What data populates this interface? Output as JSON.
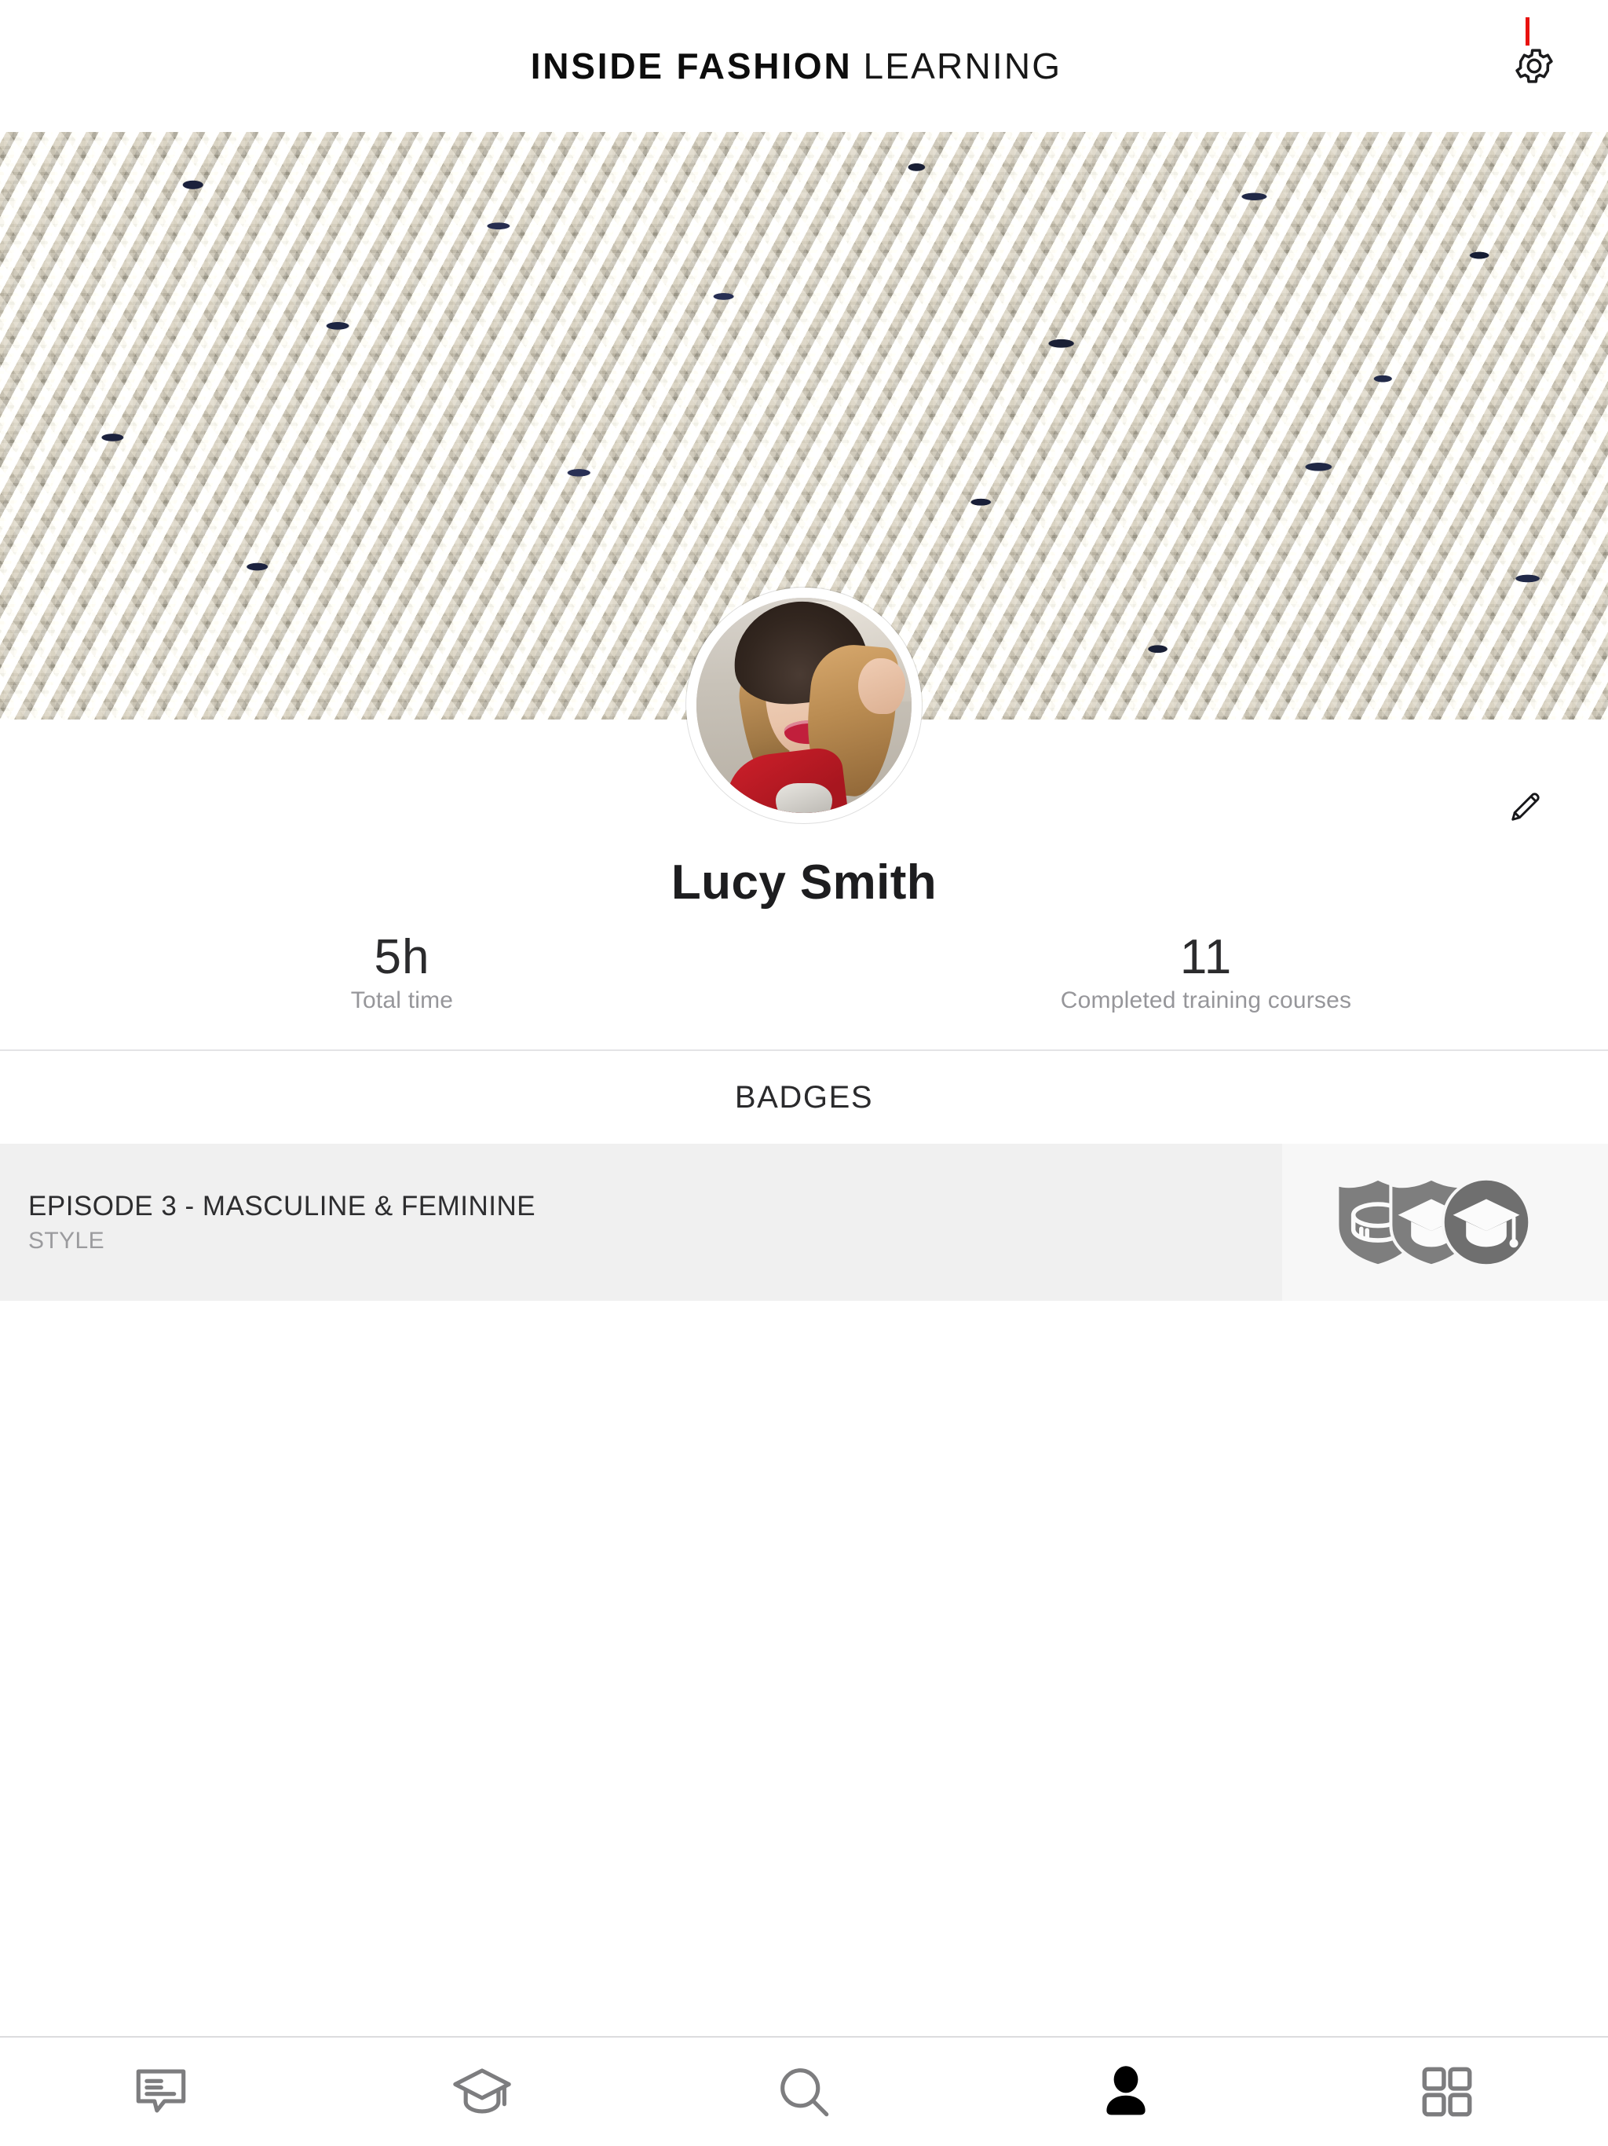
{
  "header": {
    "logo_strong": "INSIDE FASHION",
    "logo_light": "LEARNING",
    "settings_icon": "gear-icon",
    "status_indicator_color": "#e8120f"
  },
  "banner": {
    "alt": "tweed-fabric-texture",
    "base_color": "#d9d1c0",
    "accent_color": "#232a44"
  },
  "profile": {
    "avatar_alt": "user-avatar-photo",
    "edit_icon": "pencil-icon",
    "name": "Lucy Smith",
    "stats": [
      {
        "value": "5h",
        "label": "Total time"
      },
      {
        "value": "11",
        "label": "Completed training courses"
      }
    ]
  },
  "badges": {
    "heading": "BADGES",
    "items": [
      {
        "title": "EPISODE 3 - MASCULINE & FEMININE",
        "subtitle": "STYLE",
        "icons": [
          "shield-hat-badge-icon",
          "shield-graduation-badge-icon",
          "circle-graduation-badge-icon"
        ],
        "badge_color": "#7e7e7e",
        "row_bg": "#f0f0f0"
      }
    ]
  },
  "bottom_nav": {
    "items": [
      {
        "name": "chat-icon",
        "label": "Chat",
        "active": false
      },
      {
        "name": "graduation-cap-icon",
        "label": "Learning",
        "active": false
      },
      {
        "name": "search-icon",
        "label": "Search",
        "active": false
      },
      {
        "name": "person-icon",
        "label": "Profile",
        "active": true
      },
      {
        "name": "grid-icon",
        "label": "More",
        "active": false
      }
    ],
    "inactive_color": "#7d7d7f",
    "active_color": "#000000"
  }
}
